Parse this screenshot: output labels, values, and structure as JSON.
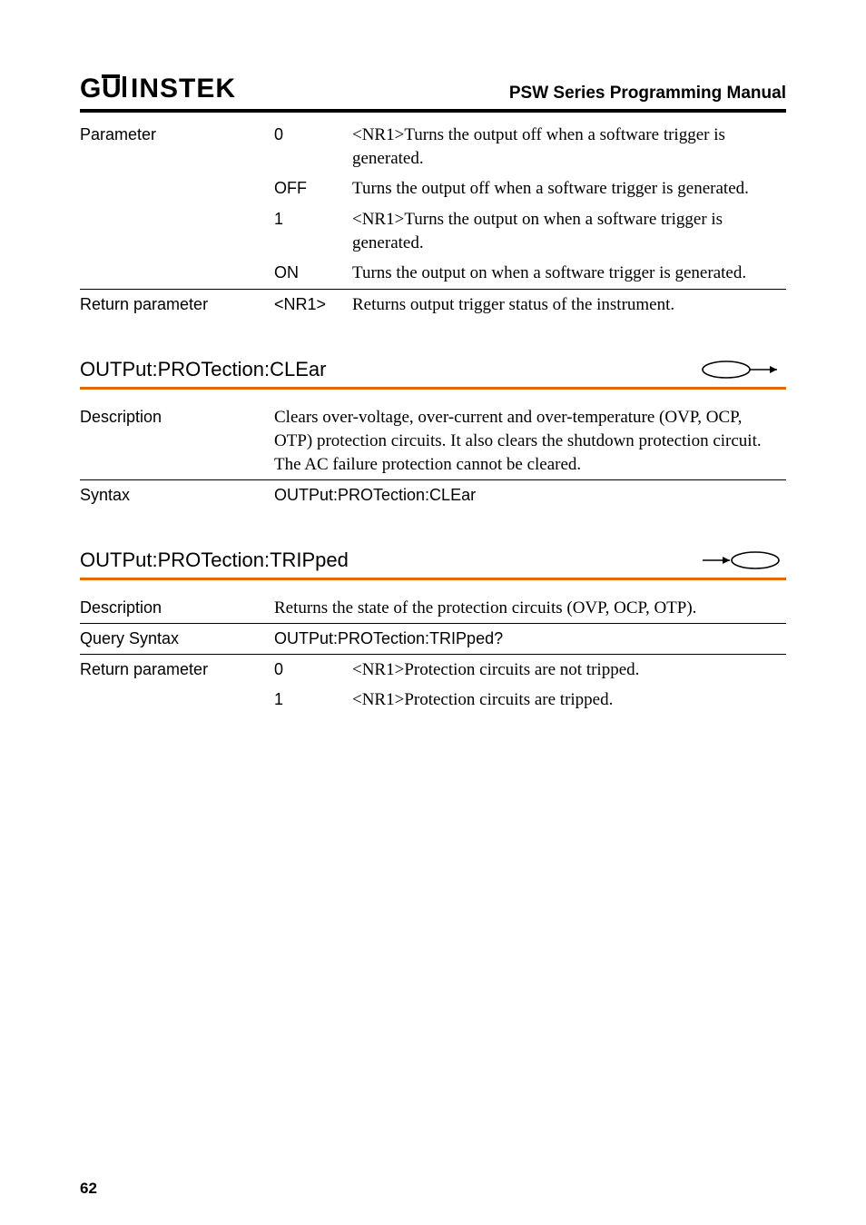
{
  "header": {
    "logo": "GWINSTEK",
    "title": "PSW Series Programming Manual"
  },
  "top_table": {
    "param_label": "Parameter",
    "rows": [
      {
        "p": "0",
        "d": "<NR1>Turns the output off when a software trigger is generated."
      },
      {
        "p": "OFF",
        "d": "Turns the output off when a software trigger is generated."
      },
      {
        "p": "1",
        "d": "<NR1>Turns the output on when a software trigger is generated."
      },
      {
        "p": "ON",
        "d": "Turns the output on when a software trigger is generated."
      }
    ],
    "return_label": "Return parameter",
    "return_param": "<NR1>",
    "return_desc": "Returns output trigger status of the instrument."
  },
  "clear": {
    "title": "OUTPut:PROTection:CLEar",
    "desc_label": "Description",
    "desc": "Clears over-voltage, over-current and over-temperature (OVP, OCP, OTP) protection circuits. It also clears the shutdown protection circuit.  The AC failure protection cannot be cleared.",
    "syntax_label": "Syntax",
    "syntax": "OUTPut:PROTection:CLEar"
  },
  "tripped": {
    "title": "OUTPut:PROTection:TRIPped",
    "desc_label": "Description",
    "desc": "Returns the state of the protection circuits (OVP, OCP, OTP).",
    "query_label": "Query Syntax",
    "query": "OUTPut:PROTection:TRIPped?",
    "return_label": "Return parameter",
    "rows": [
      {
        "p": "0",
        "d": "<NR1>Protection circuits are not tripped."
      },
      {
        "p": "1",
        "d": "<NR1>Protection circuits are tripped."
      }
    ]
  },
  "page_number": "62"
}
